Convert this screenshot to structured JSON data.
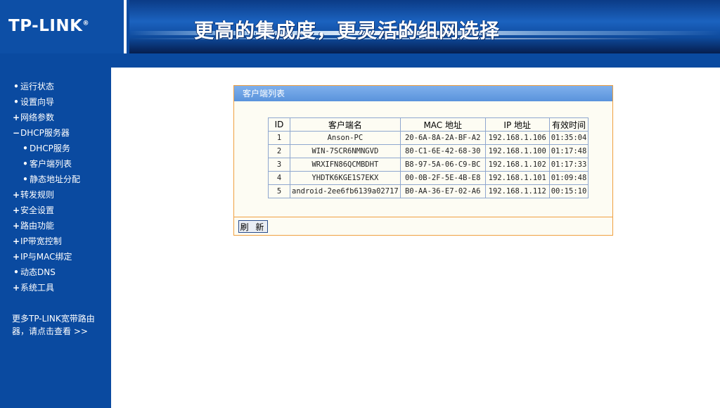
{
  "header": {
    "logo": "TP-LINK",
    "logo_reg": "®",
    "slogan": "更高的集成度，更灵活的组网选择"
  },
  "sidebar": {
    "items": [
      {
        "marker": "•",
        "label": "运行状态"
      },
      {
        "marker": "•",
        "label": "设置向导"
      },
      {
        "marker": "+",
        "label": "网络参数"
      },
      {
        "marker": "−",
        "label": "DHCP服务器"
      },
      {
        "marker": "•",
        "label": "DHCP服务"
      },
      {
        "marker": "•",
        "label": "客户端列表"
      },
      {
        "marker": "•",
        "label": "静态地址分配"
      },
      {
        "marker": "+",
        "label": "转发规则"
      },
      {
        "marker": "+",
        "label": "安全设置"
      },
      {
        "marker": "+",
        "label": "路由功能"
      },
      {
        "marker": "+",
        "label": "IP带宽控制"
      },
      {
        "marker": "+",
        "label": "IP与MAC绑定"
      },
      {
        "marker": "•",
        "label": "动态DNS"
      },
      {
        "marker": "+",
        "label": "系统工具"
      }
    ],
    "more_line1": "更多TP-LINK宽带路由",
    "more_line2": "器，请点击查看 >>"
  },
  "panel": {
    "title": "客户端列表",
    "refresh_label": "刷 新"
  },
  "table": {
    "headers": [
      "ID",
      "客户端名",
      "MAC 地址",
      "IP 地址",
      "有效时间"
    ],
    "rows": [
      [
        "1",
        "Anson-PC",
        "20-6A-8A-2A-BF-A2",
        "192.168.1.106",
        "01:35:04"
      ],
      [
        "2",
        "WIN-7SCR6NMNGVD",
        "80-C1-6E-42-68-30",
        "192.168.1.100",
        "01:17:48"
      ],
      [
        "3",
        "WRXIFN86QCMBDHT",
        "B8-97-5A-06-C9-BC",
        "192.168.1.102",
        "01:17:33"
      ],
      [
        "4",
        "YHDTK6KGE1S7EKX",
        "00-0B-2F-5E-4B-E8",
        "192.168.1.101",
        "01:09:48"
      ],
      [
        "5",
        "android-2ee6fb6139a02717",
        "B0-AA-36-E7-02-A6",
        "192.168.1.112",
        "00:15:10"
      ]
    ]
  },
  "colors": {
    "brand_blue": "#0a4aa0",
    "panel_title": "#6ea2e6",
    "panel_border": "#f0a040"
  }
}
